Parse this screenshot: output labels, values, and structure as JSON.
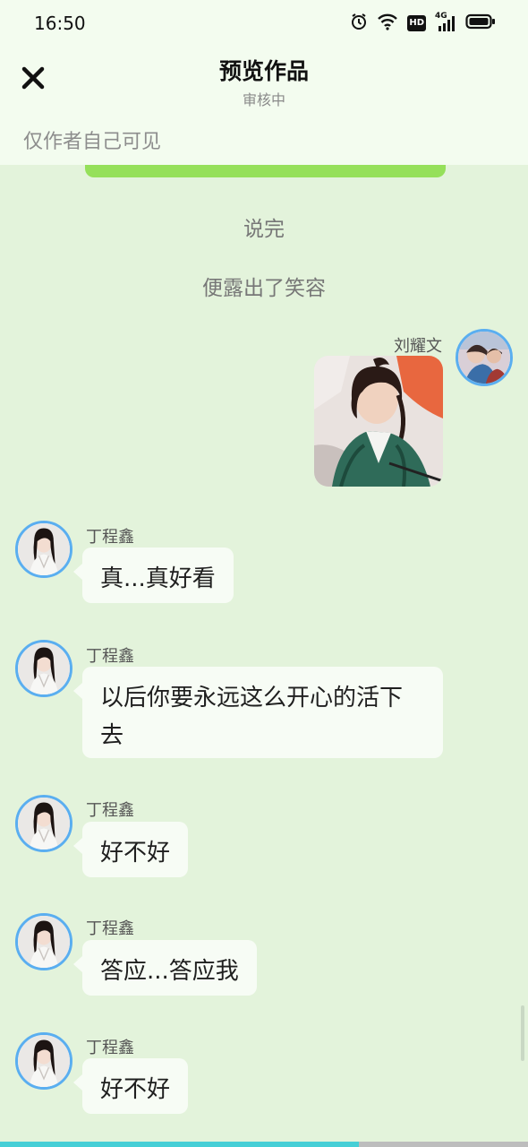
{
  "status_bar": {
    "time": "16:50",
    "icons": [
      "alarm-icon",
      "wifi-icon",
      "hd-icon",
      "signal-4g-icon",
      "battery-icon"
    ],
    "hd_label": "HD",
    "network_label": "4G"
  },
  "header": {
    "close_icon": "close-icon",
    "title": "预览作品",
    "subtitle": "审核中",
    "visibility_note": "仅作者自己可见"
  },
  "narration": [
    "说完",
    "便露出了笑容"
  ],
  "messages": [
    {
      "sender": "刘耀文",
      "side": "right",
      "type": "image"
    },
    {
      "sender": "丁程鑫",
      "side": "left",
      "type": "text",
      "text": "真...真好看"
    },
    {
      "sender": "丁程鑫",
      "side": "left",
      "type": "text",
      "text": "以后你要永远这么开心的活下去"
    },
    {
      "sender": "丁程鑫",
      "side": "left",
      "type": "text",
      "text": "好不好"
    },
    {
      "sender": "丁程鑫",
      "side": "left",
      "type": "text",
      "text": "答应...答应我"
    },
    {
      "sender": "丁程鑫",
      "side": "left",
      "type": "text",
      "text": "好不好"
    }
  ],
  "progress": {
    "fraction": 0.68
  },
  "colors": {
    "background": "#e3f3db",
    "header_bg": "#f3fcef",
    "accent_green": "#95e05a",
    "avatar_ring": "#5aaef0",
    "bubble": "#f7fcf5",
    "progress_fill": "#46cfd6"
  }
}
